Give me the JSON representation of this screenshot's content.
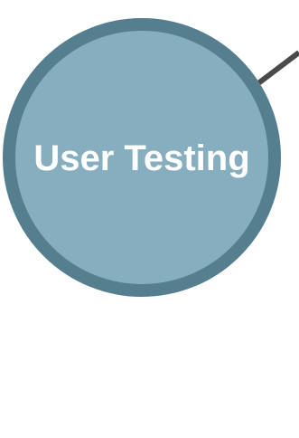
{
  "diagram": {
    "node": {
      "label": "User Testing",
      "fill_color": "#86aebf",
      "border_color": "#557f8f",
      "text_color": "#ffffff"
    },
    "connector": {
      "color": "#4a4a4a"
    }
  }
}
